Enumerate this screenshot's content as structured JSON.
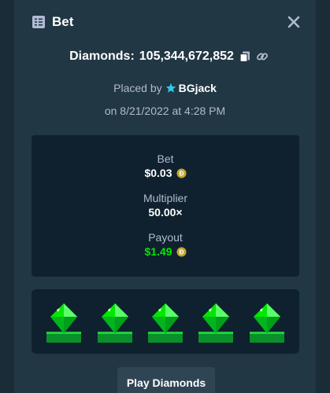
{
  "header": {
    "title": "Bet",
    "icon": "bet-slip-icon",
    "close_icon": "close-icon"
  },
  "game": {
    "name_label": "Diamonds:",
    "bet_id": "105,344,672,852",
    "copy_icon": "copy-icon",
    "link_icon": "link-icon"
  },
  "placed_by": {
    "prefix": "Placed by",
    "username": "BGjack",
    "badge_icon": "star-icon",
    "date": "on 8/21/2022 at 4:28 PM"
  },
  "stats": {
    "bet_label": "Bet",
    "bet_value": "$0.03",
    "multiplier_label": "Multiplier",
    "multiplier_value": "50.00×",
    "payout_label": "Payout",
    "payout_value": "$1.49",
    "currency_icon": "dogecoin-icon"
  },
  "result": {
    "gems": [
      "green",
      "green",
      "green",
      "green",
      "green"
    ]
  },
  "actions": {
    "play_label": "Play Diamonds"
  },
  "colors": {
    "background": "#1a2c38",
    "modal": "#213743",
    "panel": "#0f212e",
    "muted_text": "#b1bad3",
    "payout_green": "#00e701",
    "button": "#2f4553",
    "gem_green": "#00e701"
  }
}
